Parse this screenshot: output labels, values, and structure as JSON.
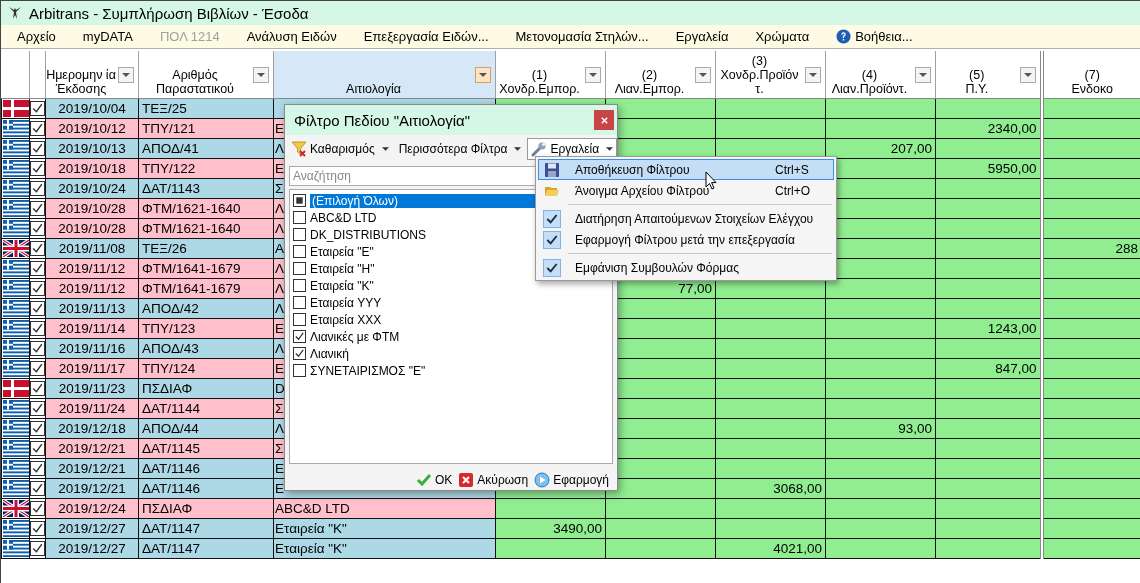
{
  "window": {
    "title": "Arbitrans - Συμπλήρωση Βιβλίων - Έσοδα"
  },
  "menu_bar": [
    {
      "label": "Αρχείο",
      "disabled": false
    },
    {
      "label": "myDATA",
      "disabled": false
    },
    {
      "label": "ΠΟΛ 1214",
      "disabled": true
    },
    {
      "label": "Ανάλυση Ειδών",
      "disabled": false
    },
    {
      "label": "Επεξεργασία Ειδών...",
      "disabled": false
    },
    {
      "label": "Μετονομασία Στηλών...",
      "disabled": false
    },
    {
      "label": "Εργαλεία",
      "disabled": false
    },
    {
      "label": "Χρώματα",
      "disabled": false
    },
    {
      "label": "Βοήθεια...",
      "disabled": false,
      "kind": "help"
    }
  ],
  "table": {
    "columns": [
      {
        "kind": "flag"
      },
      {
        "kind": "check"
      },
      {
        "kind": "date",
        "lines": [
          "Ημερομην ία",
          "Έκδοσης"
        ],
        "filter": true,
        "active": false
      },
      {
        "kind": "number",
        "lines": [
          "Αριθμός",
          "Παραστατικού"
        ],
        "filter": true,
        "active": false
      },
      {
        "kind": "reason",
        "lines": [
          "Αιτιολογία"
        ],
        "filter": true,
        "active": true
      },
      {
        "kind": "amount",
        "lines": [
          "(1)",
          "Χονδρ.Εμπορ."
        ],
        "filter": true,
        "active": false
      },
      {
        "kind": "amount",
        "lines": [
          "(2)",
          "Λιαν.Εμπορ."
        ],
        "filter": true,
        "active": false
      },
      {
        "kind": "amount",
        "lines": [
          "(3)",
          "Χονδρ.Προϊόν",
          "τ."
        ],
        "filter": true,
        "active": false
      },
      {
        "kind": "amount",
        "lines": [
          "(4)",
          "Λιαν.Προϊόντ."
        ],
        "filter": true,
        "active": false
      },
      {
        "kind": "amount",
        "lines": [
          "(5)",
          "Π.Υ."
        ],
        "filter": true,
        "active": false
      },
      {
        "kind": "amount",
        "lines": [
          "(7)",
          "Ενδοκο"
        ],
        "active": false
      }
    ],
    "rows": [
      {
        "kind": "dk",
        "checked": true,
        "color": "#add8e6",
        "date": "2019/10/04",
        "number": "ΤΕΞ/25"
      },
      {
        "kind": "gr",
        "checked": true,
        "color": "#ffc0cb",
        "date": "2019/10/12",
        "number": "ΤΠΥ/121",
        "reason": "Ε",
        "amounts": {
          "9": "2340,00"
        }
      },
      {
        "kind": "gr",
        "checked": true,
        "color": "#add8e6",
        "date": "2019/10/13",
        "number": "ΑΠΟΔ/41",
        "reason": "Λ",
        "amounts": {
          "8": "207,00"
        }
      },
      {
        "kind": "gr",
        "checked": true,
        "color": "#ffc0cb",
        "date": "2019/10/18",
        "number": "ΤΠΥ/122",
        "reason": "Ε",
        "amounts": {
          "9": "5950,00"
        }
      },
      {
        "kind": "gr",
        "checked": true,
        "color": "#add8e6",
        "date": "2019/10/24",
        "number": "ΔΑΤ/1143",
        "reason": "Σ"
      },
      {
        "kind": "gr",
        "checked": true,
        "color": "#ffc0cb",
        "date": "2019/10/28",
        "number": "ΦΤΜ/1621-1640",
        "reason": "Λ"
      },
      {
        "kind": "gr",
        "checked": true,
        "color": "#ffc0cb",
        "date": "2019/10/28",
        "number": "ΦΤΜ/1621-1640",
        "reason": "Λ"
      },
      {
        "kind": "uk",
        "checked": true,
        "color": "#add8e6",
        "date": "2019/11/08",
        "number": "ΤΕΞ/26",
        "reason": "Α",
        "amounts": {
          "10": "288"
        }
      },
      {
        "kind": "gr",
        "checked": true,
        "color": "#ffc0cb",
        "date": "2019/11/12",
        "number": "ΦΤΜ/1641-1679",
        "reason": "Λ"
      },
      {
        "kind": "gr",
        "checked": true,
        "color": "#ffc0cb",
        "date": "2019/11/12",
        "number": "ΦΤΜ/1641-1679",
        "reason": "Λ",
        "amounts": {
          "6": "77,00"
        }
      },
      {
        "kind": "gr",
        "checked": true,
        "color": "#add8e6",
        "date": "2019/11/13",
        "number": "ΑΠΟΔ/42",
        "reason": "Λ"
      },
      {
        "kind": "gr",
        "checked": true,
        "color": "#ffc0cb",
        "date": "2019/11/14",
        "number": "ΤΠΥ/123",
        "reason": "Ε",
        "amounts": {
          "9": "1243,00"
        }
      },
      {
        "kind": "gr",
        "checked": true,
        "color": "#add8e6",
        "date": "2019/11/16",
        "number": "ΑΠΟΔ/43",
        "reason": "Λ"
      },
      {
        "kind": "gr",
        "checked": true,
        "color": "#ffc0cb",
        "date": "2019/11/17",
        "number": "ΤΠΥ/124",
        "reason": "Ε",
        "amounts": {
          "9": "847,00"
        }
      },
      {
        "kind": "dk",
        "checked": true,
        "color": "#add8e6",
        "date": "2019/11/23",
        "number": "ΠΣΔΙΑΦ",
        "reason": "D"
      },
      {
        "kind": "gr",
        "checked": true,
        "color": "#ffc0cb",
        "date": "2019/11/24",
        "number": "ΔΑΤ/1144",
        "reason": "Σ"
      },
      {
        "kind": "gr",
        "checked": true,
        "color": "#add8e6",
        "date": "2019/12/18",
        "number": "ΑΠΟΔ/44",
        "reason": "Λ",
        "amounts": {
          "8": "93,00"
        }
      },
      {
        "kind": "gr",
        "checked": true,
        "color": "#ffc0cb",
        "date": "2019/12/21",
        "number": "ΔΑΤ/1145",
        "reason": "Σ"
      },
      {
        "kind": "gr",
        "checked": true,
        "color": "#add8e6",
        "date": "2019/12/21",
        "number": "ΔΑΤ/1146",
        "reason": "Ε"
      },
      {
        "kind": "gr",
        "checked": true,
        "color": "#add8e6",
        "date": "2019/12/21",
        "number": "ΔΑΤ/1146",
        "reason": "Ε",
        "amounts": {
          "7": "3068,00"
        }
      },
      {
        "kind": "uk",
        "checked": true,
        "color": "#ffc0cb",
        "date": "2019/12/24",
        "number": "ΠΣΔΙΑΦ",
        "reason": "ABC&D LTD"
      },
      {
        "kind": "gr",
        "checked": true,
        "color": "#add8e6",
        "date": "2019/12/27",
        "number": "ΔΑΤ/1147",
        "reason": "Εταιρεία \"Κ\"",
        "amounts": {
          "5": "3490,00"
        }
      },
      {
        "kind": "gr",
        "checked": true,
        "color": "#add8e6",
        "date": "2019/12/27",
        "number": "ΔΑΤ/1147",
        "reason": "Εταιρεία \"Κ\"",
        "amounts": {
          "7": "4021,00"
        }
      }
    ]
  },
  "filter_dialog": {
    "title": "Φίλτρο Πεδίου \"Αιτιολογία\"",
    "toolbar": [
      {
        "kind": "clear",
        "label": "Καθαρισμός",
        "pressed": false
      },
      {
        "kind": "more",
        "label": "Περισσότερα Φίλτρα",
        "pressed": false
      },
      {
        "kind": "tools",
        "label": "Εργαλεία",
        "pressed": true
      }
    ],
    "search": {
      "placeholder": "Αναζήτηση"
    },
    "items": [
      {
        "kind": "select_all",
        "label": "(Επιλογή Όλων)",
        "checked": true,
        "selected": true
      },
      {
        "kind": "option",
        "label": "ABC&D LTD",
        "checked": false,
        "selected": false
      },
      {
        "kind": "option",
        "label": "DK_DISTRIBUTIONS",
        "checked": false,
        "selected": false
      },
      {
        "kind": "option",
        "label": "Εταιρεία \"Ε\"",
        "checked": false,
        "selected": false
      },
      {
        "kind": "option",
        "label": "Εταιρεία \"Η\"",
        "checked": false,
        "selected": false
      },
      {
        "kind": "option",
        "label": "Εταιρεία \"Κ\"",
        "checked": false,
        "selected": false
      },
      {
        "kind": "option",
        "label": "Εταιρεία YYY",
        "checked": false,
        "selected": false
      },
      {
        "kind": "option",
        "label": "Εταιρεία XXX",
        "checked": false,
        "selected": false
      },
      {
        "kind": "option",
        "label": "Λιανικές με ΦΤΜ",
        "checked": true,
        "selected": false
      },
      {
        "kind": "option",
        "label": "Λιανική",
        "checked": true,
        "selected": false
      },
      {
        "kind": "option",
        "label": "ΣΥΝΕΤΑΙΡΙΣΜΟΣ \"Ε\"",
        "checked": false,
        "selected": false
      }
    ],
    "buttons": [
      {
        "kind": "ok",
        "label": "OK"
      },
      {
        "kind": "cancel",
        "label": "Ακύρωση"
      },
      {
        "kind": "apply",
        "label": "Εφαρμογή"
      }
    ]
  },
  "tools_menu": {
    "groups": [
      [
        {
          "kind": "save",
          "label": "Αποθήκευση Φίλτρου",
          "shortcut": "Ctrl+S",
          "selected": true
        },
        {
          "kind": "open",
          "label": "Άνοιγμα Αρχείου Φίλτρου",
          "shortcut": "Ctrl+O",
          "selected": false
        }
      ],
      [
        {
          "kind": "toggle",
          "label": "Διατήρηση Απαιτούμενων Στοιχείων Ελέγχου",
          "checked": true,
          "selected": false
        },
        {
          "kind": "toggle",
          "label": "Εφαρμογή Φίλτρου μετά την επεξεργασία",
          "checked": true,
          "selected": false
        }
      ],
      [
        {
          "kind": "toggle",
          "label": "Εμφάνιση Συμβουλών Φόρμας",
          "checked": true,
          "selected": false
        }
      ]
    ]
  }
}
